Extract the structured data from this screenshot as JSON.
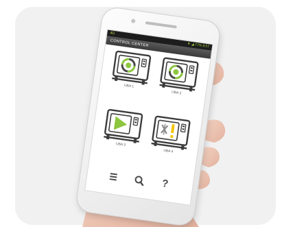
{
  "phone": {
    "status_left": "4G",
    "status_right": "▼ ◢ 77% 8:57",
    "app_title": "CONTROL CENTER"
  },
  "units": [
    {
      "label": "UBA 1",
      "status_icon": "cleaning-cycle-icon",
      "state": "running"
    },
    {
      "label": "UBA 2",
      "status_icon": "cleaning-cycle-icon",
      "state": "running"
    },
    {
      "label": "UBA 3",
      "status_icon": "play-icon",
      "state": "ready"
    },
    {
      "label": "UBA 4",
      "status_icon": "error-warning-icon",
      "state": "fault"
    }
  ],
  "toolbar": {
    "menu_icon": "menu-icon",
    "search_icon": "search-icon",
    "help_label": "?"
  },
  "colors": {
    "accent_green": "#8dc63f",
    "warning_yellow": "#f2c500",
    "status_bar": "#1d1d1d",
    "card_background": "#f1f1f1"
  }
}
